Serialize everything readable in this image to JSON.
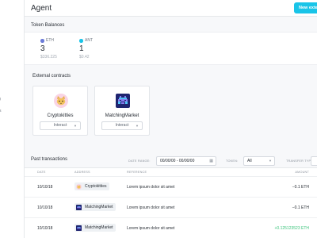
{
  "sidebar": {
    "items": [
      "g",
      "s"
    ]
  },
  "header": {
    "title": "Agent",
    "new_button": "New exte"
  },
  "balances": {
    "title": "Token Balances",
    "tokens": [
      {
        "symbol": "ETH",
        "amount": "3",
        "fiat": "$336.225",
        "color": "#6a7bd8"
      },
      {
        "symbol": "ANT",
        "amount": "1",
        "fiat": "$0.42",
        "color": "#19c4e8"
      }
    ]
  },
  "contracts": {
    "title": "External contracts",
    "items": [
      {
        "name": "Cryptokitties",
        "action": "Interact",
        "icon": "cat-icon"
      },
      {
        "name": "MatchingMarket",
        "action": "Interact",
        "icon": "invader-icon"
      }
    ]
  },
  "transactions": {
    "title": "Past transactions",
    "filters": {
      "date_label": "DATE RANGE:",
      "date_value": "00/00/00 - 00/00/00",
      "token_label": "TOKEN:",
      "token_value": "All",
      "type_label": "TRANSFER TYPE:"
    },
    "columns": {
      "date": "DATE",
      "address": "ADDRESS",
      "reference": "REFERENCE",
      "amount": "AMOUNT"
    },
    "rows": [
      {
        "date": "10/10/18",
        "address": "Cryptokitties",
        "reference": "Lorem ipsum dolor sit amet",
        "amount": "−0.1 ETH",
        "amount_color": "#1d232b",
        "icon": "cat-icon"
      },
      {
        "date": "10/10/18",
        "address": "MatchingMarket",
        "reference": "Lorem ipsum dolor sit amet",
        "amount": "−0.1 ETH",
        "amount_color": "#1d232b",
        "icon": "invader-icon"
      },
      {
        "date": "10/10/18",
        "address": "MatchingMarket",
        "reference": "Lorem ipsum dolor sit amet",
        "amount": "+0.125123523 ETH",
        "amount_color": "#3cc47c",
        "icon": "invader-icon"
      }
    ]
  }
}
